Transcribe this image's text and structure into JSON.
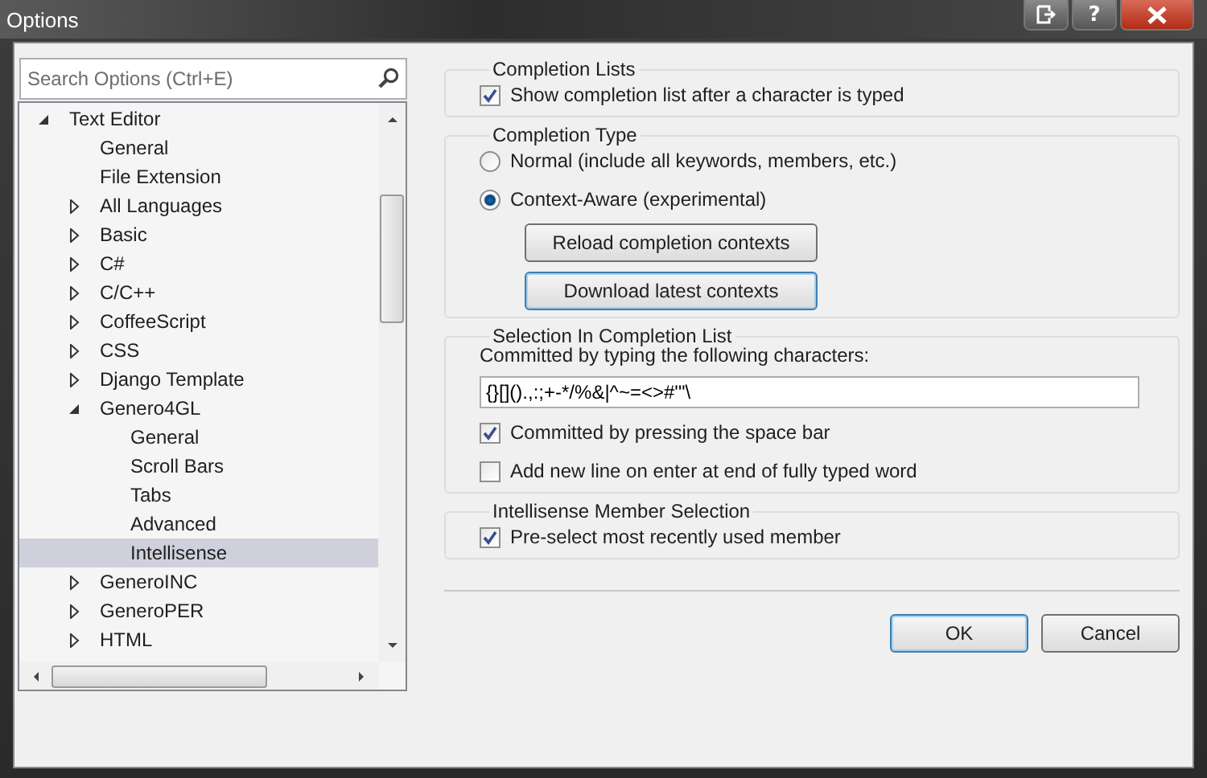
{
  "window": {
    "title": "Options",
    "help_label": "?"
  },
  "search": {
    "placeholder": "Search Options (Ctrl+E)"
  },
  "tree": [
    {
      "label": "Text Editor",
      "expanded": true,
      "selected": false,
      "children": [
        {
          "label": "General",
          "selected": false
        },
        {
          "label": "File Extension",
          "selected": false
        },
        {
          "label": "All Languages",
          "expanded": false,
          "selected": false
        },
        {
          "label": "Basic",
          "expanded": false,
          "selected": false
        },
        {
          "label": "C#",
          "expanded": false,
          "selected": false
        },
        {
          "label": "C/C++",
          "expanded": false,
          "selected": false
        },
        {
          "label": "CoffeeScript",
          "expanded": false,
          "selected": false
        },
        {
          "label": "CSS",
          "expanded": false,
          "selected": false
        },
        {
          "label": "Django Template",
          "expanded": false,
          "selected": false
        },
        {
          "label": "Genero4GL",
          "expanded": true,
          "selected": false,
          "children": [
            {
              "label": "General",
              "selected": false
            },
            {
              "label": "Scroll Bars",
              "selected": false
            },
            {
              "label": "Tabs",
              "selected": false
            },
            {
              "label": "Advanced",
              "selected": false
            },
            {
              "label": "Intellisense",
              "selected": true
            }
          ]
        },
        {
          "label": "GeneroINC",
          "expanded": false,
          "selected": false
        },
        {
          "label": "GeneroPER",
          "expanded": false,
          "selected": false
        },
        {
          "label": "HTML",
          "expanded": false,
          "selected": false
        }
      ]
    }
  ],
  "groups": [
    {
      "title": "Completion Lists",
      "items": [
        {
          "kind": "checkbox",
          "label": "Show completion list after a character is typed",
          "checked": true
        }
      ]
    },
    {
      "title": "Completion Type",
      "items": [
        {
          "kind": "radio",
          "label": "Normal (include all keywords, members, etc.)",
          "selected": false
        },
        {
          "kind": "radio",
          "label": "Context-Aware (experimental)",
          "selected": true
        },
        {
          "kind": "button",
          "label": "Reload completion contexts",
          "focused": false
        },
        {
          "kind": "button",
          "label": "Download latest contexts",
          "focused": true
        }
      ]
    },
    {
      "title": "Selection In Completion List",
      "items": [
        {
          "kind": "label",
          "label": "Committed by typing the following characters:"
        },
        {
          "kind": "field",
          "value": "{}[]().,:;+-*/%&|^~=<>#'\"\\"
        },
        {
          "kind": "checkbox",
          "label": "Committed by pressing the space bar",
          "checked": true
        },
        {
          "kind": "checkbox",
          "label": "Add new line on enter at end of fully typed word",
          "checked": false
        }
      ]
    },
    {
      "title": "Intellisense Member Selection",
      "items": [
        {
          "kind": "checkbox",
          "label": "Pre-select most recently used member",
          "checked": true
        }
      ]
    }
  ],
  "buttons": [
    {
      "label": "OK",
      "default": true
    },
    {
      "label": "Cancel",
      "default": false
    }
  ]
}
